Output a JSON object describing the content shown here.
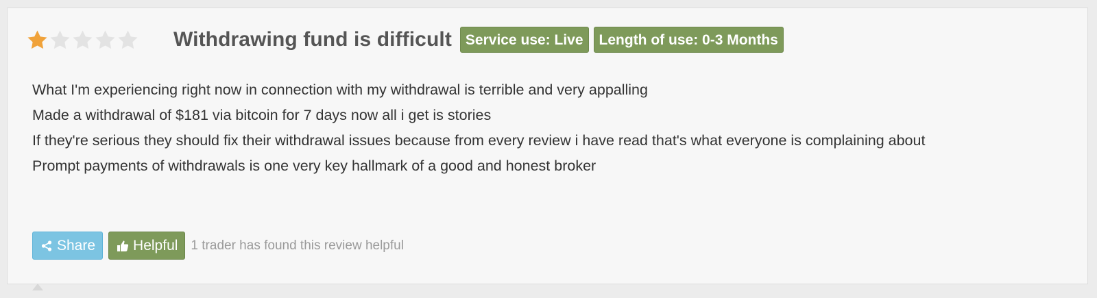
{
  "review": {
    "rating": 1,
    "max_rating": 5,
    "star_filled_color": "#f0a23a",
    "star_empty_color": "#e3e3e3",
    "title": "Withdrawing fund is difficult",
    "badges": [
      {
        "label": "Service use: Live"
      },
      {
        "label": "Length of use: 0-3 Months"
      }
    ],
    "badge_color": "#7e9a5a",
    "body_lines": [
      "What I'm experiencing right now in connection with my withdrawal is terrible and very appalling",
      "Made a withdrawal of $181 via bitcoin for 7 days now all i get is stories",
      "If they're serious they should fix their withdrawal issues because from every review i have read that's what everyone is complaining about",
      "Prompt payments of withdrawals is one very key hallmark of a good and honest broker"
    ]
  },
  "actions": {
    "share_label": "Share",
    "share_icon": "share-icon",
    "helpful_label": "Helpful",
    "helpful_icon": "thumbs-up-icon",
    "helpful_count_text": "1 trader has found this review helpful",
    "share_color": "#7cc4e2",
    "helpful_color": "#7e9a5a"
  }
}
